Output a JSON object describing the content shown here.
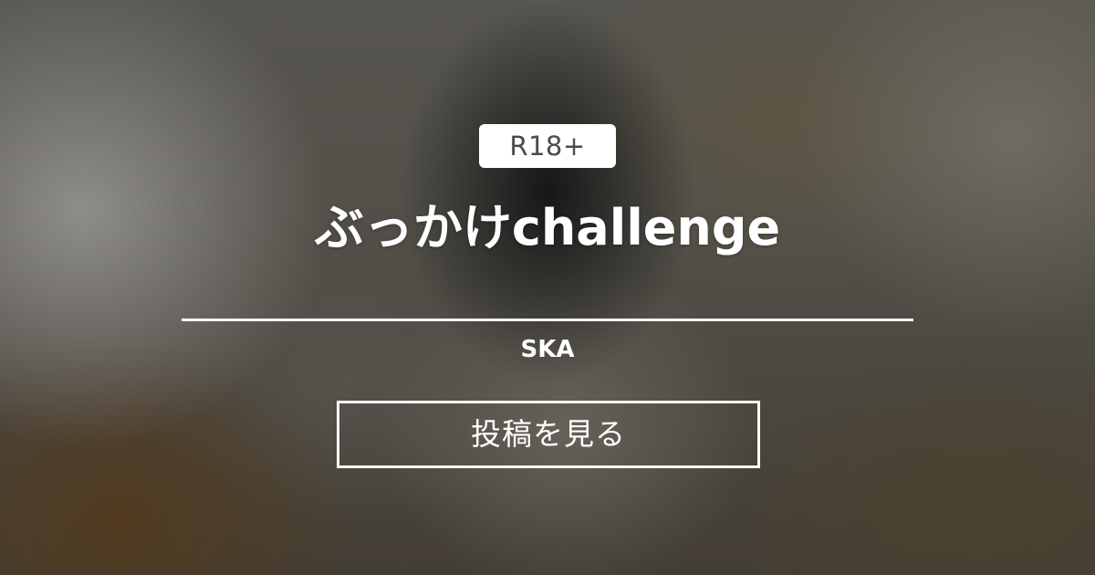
{
  "card": {
    "badge": "R18+",
    "title": "ぶっかけchallenge",
    "author": "SKA",
    "view_button_label": "投稿を見る"
  },
  "colors": {
    "badge_background": "#ffffff",
    "badge_text": "#4b4b4b",
    "text": "#ffffff",
    "background_tone": "#4a4742"
  }
}
